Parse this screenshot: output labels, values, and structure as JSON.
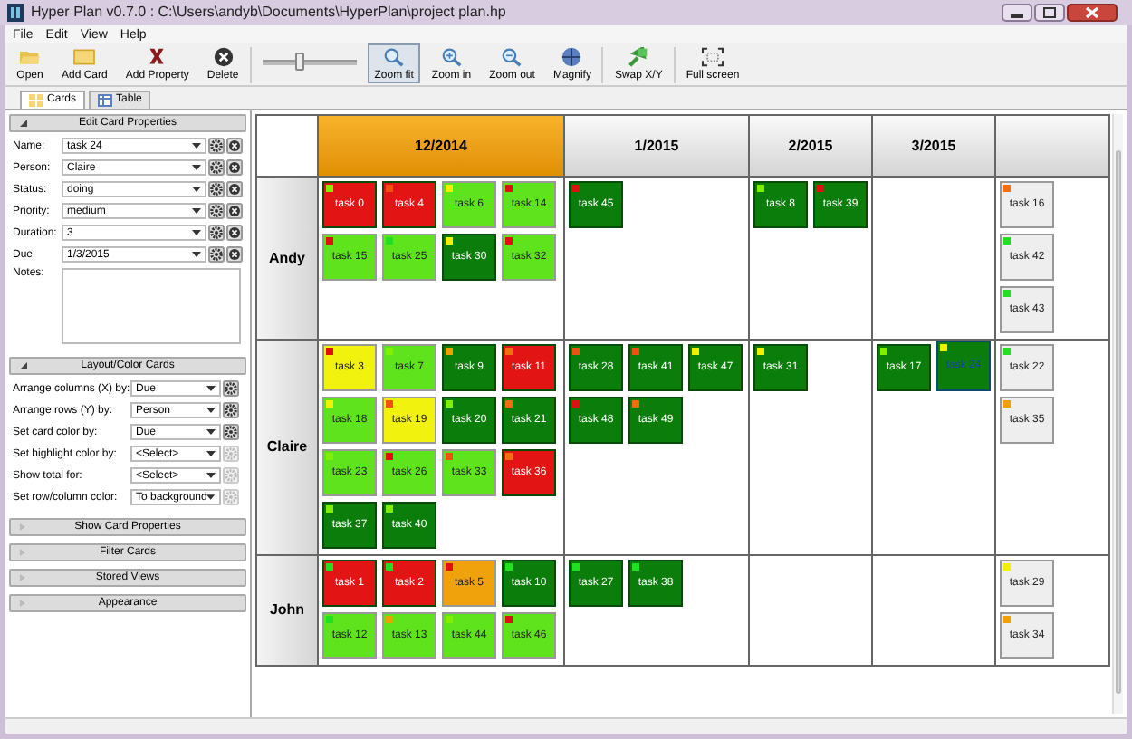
{
  "window": {
    "title": "Hyper Plan v0.7.0 : C:\\Users\\andyb\\Documents\\HyperPlan\\project plan.hp"
  },
  "menu": [
    "File",
    "Edit",
    "View",
    "Help"
  ],
  "toolbar": [
    {
      "kind": "open",
      "label": "Open",
      "selected": false
    },
    {
      "kind": "add-card",
      "label": "Add Card",
      "selected": false
    },
    {
      "kind": "add-property",
      "label": "Add Property",
      "selected": false
    },
    {
      "kind": "delete",
      "label": "Delete",
      "selected": false
    },
    {
      "kind": "slider",
      "level": 0.4
    },
    {
      "kind": "zoom-fit",
      "label": "Zoom fit",
      "selected": true
    },
    {
      "kind": "zoom-in",
      "label": "Zoom in",
      "selected": false
    },
    {
      "kind": "zoom-out",
      "label": "Zoom out",
      "selected": false
    },
    {
      "kind": "magnify",
      "label": "Magnify",
      "selected": false
    },
    {
      "kind": "swap",
      "label": "Swap X/Y",
      "selected": false
    },
    {
      "kind": "full-screen",
      "label": "Full screen",
      "selected": false
    }
  ],
  "tabs": [
    {
      "label": "Cards",
      "selected": true
    },
    {
      "label": "Table",
      "selected": false
    }
  ],
  "sidebar": {
    "sections": [
      {
        "title": "Edit Card Properties",
        "expanded": true,
        "kind": "properties",
        "fields": [
          {
            "label": "Name:",
            "value": "task 24"
          },
          {
            "label": "Person:",
            "value": "Claire"
          },
          {
            "label": "Status:",
            "value": "doing"
          },
          {
            "label": "Priority:",
            "value": "medium"
          },
          {
            "label": "Duration:",
            "value": "3"
          },
          {
            "label": "Due",
            "value": "1/3/2015"
          }
        ],
        "notes_label": "Notes:"
      },
      {
        "title": "Layout/Color Cards",
        "expanded": true,
        "kind": "layout",
        "fields": [
          {
            "label": "Arrange columns (X) by:",
            "value": "Due",
            "disabled": false
          },
          {
            "label": "Arrange rows (Y) by:",
            "value": "Person",
            "disabled": false
          },
          {
            "label": "Set card color by:",
            "value": "Due",
            "disabled": false
          },
          {
            "label": "Set highlight color by:",
            "value": "<Select>",
            "disabled": true
          },
          {
            "label": "Show total for:",
            "value": "<Select>",
            "disabled": true
          },
          {
            "label": "Set row/column color:",
            "value": "To background",
            "disabled": true
          }
        ]
      },
      {
        "title": "Show Card Properties",
        "expanded": false
      },
      {
        "title": "Filter Cards",
        "expanded": false
      },
      {
        "title": "Stored Views",
        "expanded": false
      },
      {
        "title": "Appearance",
        "expanded": false
      }
    ]
  },
  "board": {
    "columns": [
      {
        "label": "12/2014",
        "highlighted": true
      },
      {
        "label": "1/2015",
        "highlighted": false
      },
      {
        "label": "2/2015",
        "highlighted": false
      },
      {
        "label": "3/2015",
        "highlighted": false
      },
      {
        "highlighted": false
      }
    ],
    "rows": [
      {
        "label": "Andy",
        "cells": [
          [
            {
              "name": "task 0",
              "color": "#e31414",
              "marker": {
                "color": "#80f000"
              },
              "selected": false
            },
            {
              "name": "task 4",
              "color": "#e31414",
              "marker": {
                "color": "#f05010"
              },
              "selected": false
            },
            {
              "name": "task 6",
              "color": "#5fe31d",
              "marker": {
                "color": "#f0f000"
              },
              "selected": false
            },
            {
              "name": "task 14",
              "color": "#5fe31d",
              "marker": {
                "color": "#e01010"
              },
              "selected": false
            },
            {
              "name": "task 15",
              "color": "#5fe31d",
              "marker": {
                "color": "#e01010"
              },
              "selected": false
            },
            {
              "name": "task 25",
              "color": "#5fe31d",
              "marker": {
                "color": "#20e020"
              },
              "selected": false
            },
            {
              "name": "task 30",
              "color": "#0b7d0b",
              "marker": {
                "color": "#f0f000"
              },
              "selected": false
            },
            {
              "name": "task 32",
              "color": "#5fe31d",
              "marker": {
                "color": "#e01010"
              },
              "selected": false
            }
          ],
          [
            {
              "name": "task 45",
              "color": "#0b7d0b",
              "marker": {
                "color": "#e01010"
              },
              "selected": false
            }
          ],
          [
            {
              "name": "task 8",
              "color": "#0b7d0b",
              "marker": {
                "color": "#80f000"
              },
              "selected": false
            },
            {
              "name": "task 39",
              "color": "#0b7d0b",
              "marker": {
                "color": "#e01010"
              },
              "selected": false
            }
          ],
          [],
          [
            {
              "name": "task 16",
              "color": "#eeeeee",
              "marker": {
                "color": "#f07010"
              },
              "selected": false
            },
            {
              "name": "task 42",
              "color": "#eeeeee",
              "marker": {
                "color": "#20e020"
              },
              "selected": false
            },
            {
              "name": "task 43",
              "color": "#eeeeee",
              "marker": {
                "color": "#20e020"
              },
              "selected": false
            }
          ]
        ]
      },
      {
        "label": "Claire",
        "cells": [
          [
            {
              "name": "task 3",
              "color": "#f2f20f",
              "marker": {
                "color": "#e01010"
              },
              "selected": false
            },
            {
              "name": "task 7",
              "color": "#5fe31d",
              "marker": {
                "color": "#80f000"
              },
              "selected": false
            },
            {
              "name": "task 9",
              "color": "#0b7d0b",
              "marker": {
                "color": "#f0a000"
              },
              "selected": false
            },
            {
              "name": "task 11",
              "color": "#e31414",
              "marker": {
                "color": "#f07010"
              },
              "selected": false
            },
            {
              "name": "task 18",
              "color": "#5fe31d",
              "marker": {
                "color": "#f0f000"
              },
              "selected": false
            },
            {
              "name": "task 19",
              "color": "#f2f20f",
              "marker": {
                "color": "#f05010"
              },
              "selected": false
            },
            {
              "name": "task 20",
              "color": "#0b7d0b",
              "marker": {
                "color": "#80f000"
              },
              "selected": false
            },
            {
              "name": "task 21",
              "color": "#0b7d0b",
              "marker": {
                "color": "#f07010"
              },
              "selected": false
            },
            {
              "name": "task 23",
              "color": "#5fe31d",
              "marker": {
                "color": "#80f000"
              },
              "selected": false
            },
            {
              "name": "task 26",
              "color": "#5fe31d",
              "marker": {
                "color": "#e01010"
              },
              "selected": false
            },
            {
              "name": "task 33",
              "color": "#5fe31d",
              "marker": {
                "color": "#f05010"
              },
              "selected": false
            },
            {
              "name": "task 36",
              "color": "#e31414",
              "marker": {
                "color": "#f07010"
              },
              "selected": false
            },
            {
              "name": "task 37",
              "color": "#0b7d0b",
              "marker": {
                "color": "#80f000"
              },
              "selected": false
            },
            {
              "name": "task 40",
              "color": "#0b7d0b",
              "marker": {
                "color": "#80f000"
              },
              "selected": false
            }
          ],
          [
            {
              "name": "task 28",
              "color": "#0b7d0b",
              "marker": {
                "color": "#f05010"
              },
              "selected": false
            },
            {
              "name": "task 41",
              "color": "#0b7d0b",
              "marker": {
                "color": "#f05010"
              },
              "selected": false
            },
            {
              "name": "task 47",
              "color": "#0b7d0b",
              "marker": {
                "color": "#f0f000"
              },
              "selected": false
            },
            {
              "name": "task 48",
              "color": "#0b7d0b",
              "marker": {
                "color": "#e01010"
              },
              "selected": false
            },
            {
              "name": "task 49",
              "color": "#0b7d0b",
              "marker": {
                "color": "#f07010"
              },
              "selected": false
            }
          ],
          [
            {
              "name": "task 31",
              "color": "#0b7d0b",
              "marker": {
                "color": "#f0f000"
              },
              "selected": false
            }
          ],
          [
            {
              "name": "task 17",
              "color": "#0b7d0b",
              "marker": {
                "color": "#80f000"
              },
              "selected": false
            },
            {
              "name": "task 24",
              "color": "#0b7d0b",
              "marker": {
                "color": "#f0f000"
              },
              "selected": true
            }
          ],
          [
            {
              "name": "task 22",
              "color": "#eeeeee",
              "marker": {
                "color": "#20e020"
              },
              "selected": false
            },
            {
              "name": "task 35",
              "color": "#eeeeee",
              "marker": {
                "color": "#f0a000"
              },
              "selected": false
            }
          ]
        ]
      },
      {
        "label": "John",
        "cells": [
          [
            {
              "name": "task 1",
              "color": "#e31414",
              "marker": {
                "color": "#20e020"
              },
              "selected": false
            },
            {
              "name": "task 2",
              "color": "#e31414",
              "marker": {
                "color": "#20e020"
              },
              "selected": false
            },
            {
              "name": "task 5",
              "color": "#f0a20c",
              "marker": {
                "color": "#e01010"
              },
              "selected": false
            },
            {
              "name": "task 10",
              "color": "#0b7d0b",
              "marker": {
                "color": "#20e020"
              },
              "selected": false
            },
            {
              "name": "task 12",
              "color": "#5fe31d",
              "marker": {
                "color": "#20e020"
              },
              "selected": false
            },
            {
              "name": "task 13",
              "color": "#5fe31d",
              "marker": {
                "color": "#f0a000"
              },
              "selected": false
            },
            {
              "name": "task 44",
              "color": "#5fe31d",
              "marker": {
                "color": "#80f000"
              },
              "selected": false
            },
            {
              "name": "task 46",
              "color": "#5fe31d",
              "marker": {
                "color": "#e01010"
              },
              "selected": false
            }
          ],
          [
            {
              "name": "task 27",
              "color": "#0b7d0b",
              "marker": {
                "color": "#20e020"
              },
              "selected": false
            },
            {
              "name": "task 38",
              "color": "#0b7d0b",
              "marker": {
                "color": "#20e020"
              },
              "selected": false
            }
          ],
          [],
          [],
          [
            {
              "name": "task 29",
              "color": "#eeeeee",
              "marker": {
                "color": "#f0f000"
              },
              "selected": false
            },
            {
              "name": "task 34",
              "color": "#eeeeee",
              "marker": {
                "color": "#f0a000"
              },
              "selected": false
            }
          ]
        ]
      }
    ]
  }
}
